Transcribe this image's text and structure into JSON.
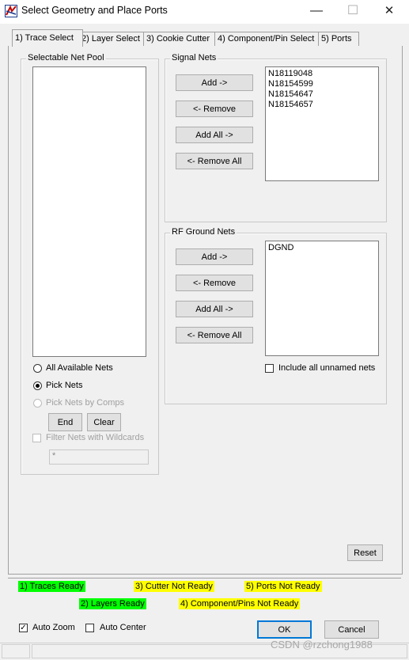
{
  "window": {
    "title": "Select Geometry and Place Ports",
    "minimize_glyph": "—",
    "maximize_glyph": "☐",
    "close_glyph": "✕"
  },
  "tabs": [
    {
      "label": "1) Trace Select",
      "active": true
    },
    {
      "label": "2) Layer Select",
      "active": false
    },
    {
      "label": "3) Cookie Cutter",
      "active": false
    },
    {
      "label": "4) Component/Pin Select",
      "active": false
    },
    {
      "label": "5) Ports",
      "active": false
    }
  ],
  "net_pool": {
    "group_label": "Selectable Net Pool",
    "options": {
      "all_nets": "All Available Nets",
      "pick_nets": "Pick Nets",
      "pick_by_comps": "Pick Nets by Comps"
    },
    "selected_option": "pick_nets",
    "end_label": "End",
    "clear_label": "Clear",
    "filter_label": "Filter Nets with Wildcards",
    "filter_value": "*"
  },
  "signal_nets": {
    "group_label": "Signal Nets",
    "add_label": "Add ->",
    "remove_label": "<- Remove",
    "add_all_label": "Add All ->",
    "remove_all_label": "<- Remove All",
    "items": [
      "N18119048",
      "N18154599",
      "N18154647",
      "N18154657"
    ]
  },
  "rf_ground_nets": {
    "group_label": "RF Ground Nets",
    "add_label": "Add ->",
    "remove_label": "<- Remove",
    "add_all_label": "Add All ->",
    "remove_all_label": "<- Remove All",
    "items": [
      "DGND"
    ],
    "include_unnamed_label": "Include all unnamed nets",
    "include_unnamed_checked": false
  },
  "reset_label": "Reset",
  "status": {
    "traces": "1) Traces Ready",
    "layers": "2) Layers Ready",
    "cutter": "3) Cutter Not Ready",
    "components": "4) Component/Pins Not Ready",
    "ports": "5) Ports Not Ready",
    "ready_color": "#00ff00",
    "not_ready_color": "#ffff00"
  },
  "footer": {
    "auto_zoom_label": "Auto Zoom",
    "auto_zoom_checked": true,
    "auto_center_label": "Auto Center",
    "auto_center_checked": false,
    "ok_label": "OK",
    "cancel_label": "Cancel"
  },
  "watermark": "CSDN @rzchong1988"
}
